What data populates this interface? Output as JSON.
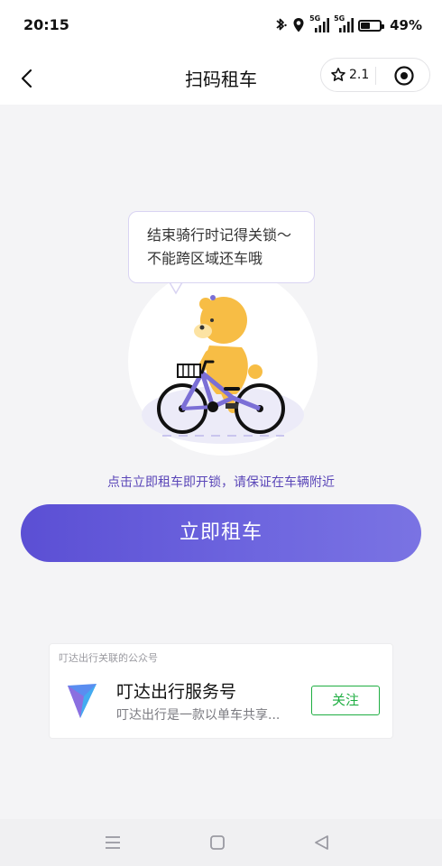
{
  "status_bar": {
    "time": "20:15",
    "battery_pct": "49%",
    "network_1": "5G",
    "network_2": "5G",
    "battery_level": 0.49
  },
  "nav": {
    "title": "扫码租车",
    "capsule_rating": "2.1"
  },
  "hero": {
    "bubble_line1": "结束骑行时记得关锁～",
    "bubble_line2": "不能跨区域还车哦"
  },
  "hint": "点击立即租车即开锁，请保证在车辆附近",
  "rent_button": "立即租车",
  "official_account": {
    "header": "叮达出行关联的公众号",
    "name": "叮达出行服务号",
    "desc": "叮达出行是一款以单车共享...",
    "follow_label": "关注"
  },
  "colors": {
    "accent_start": "#5b4fd4",
    "accent_end": "#7a73e3",
    "hint_text": "#5a46b8",
    "follow_green": "#1fae42",
    "bg": "#f4f4f6"
  }
}
